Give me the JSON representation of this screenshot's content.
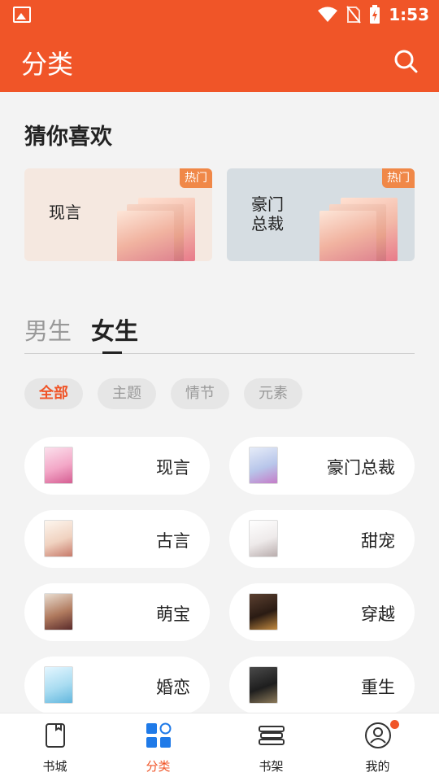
{
  "status_bar": {
    "time": "1:53"
  },
  "app_bar": {
    "title": "分类"
  },
  "guess": {
    "title": "猜你喜欢",
    "cards": [
      {
        "label": "现言",
        "badge": "热门"
      },
      {
        "label": "豪门\n总裁",
        "badge": "热门"
      }
    ]
  },
  "gender_tabs": [
    {
      "label": "男生",
      "selected": false
    },
    {
      "label": "女生",
      "selected": true
    }
  ],
  "filters": [
    {
      "label": "全部",
      "selected": true
    },
    {
      "label": "主题",
      "selected": false
    },
    {
      "label": "情节",
      "selected": false
    },
    {
      "label": "元素",
      "selected": false
    }
  ],
  "categories": [
    {
      "name": "现言"
    },
    {
      "name": "豪门总裁"
    },
    {
      "name": "古言"
    },
    {
      "name": "甜宠"
    },
    {
      "name": "萌宝"
    },
    {
      "name": "穿越"
    },
    {
      "name": "婚恋"
    },
    {
      "name": "重生"
    }
  ],
  "bottom_nav": [
    {
      "label": "书城",
      "icon": "book-icon"
    },
    {
      "label": "分类",
      "icon": "category-grid-icon",
      "active": true
    },
    {
      "label": "书架",
      "icon": "bookshelf-icon"
    },
    {
      "label": "我的",
      "icon": "profile-icon",
      "badge": true
    }
  ],
  "colors": {
    "accent": "#f05528",
    "hot_badge": "#f08848"
  }
}
